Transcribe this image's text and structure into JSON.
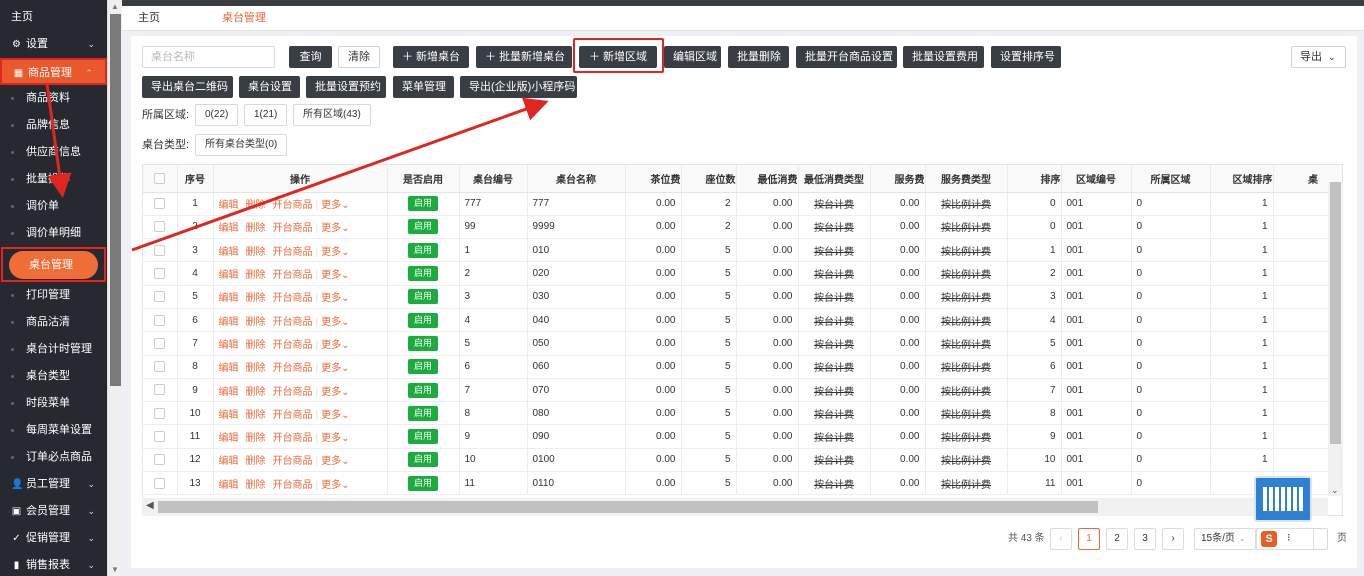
{
  "sidebar": {
    "items": [
      {
        "label": "主页"
      },
      {
        "label": "设置",
        "icon": "gear-icon"
      },
      {
        "label": "商品管理",
        "icon": "grid-icon"
      },
      {
        "label": "商品资料"
      },
      {
        "label": "品牌信息"
      },
      {
        "label": "供应商信息"
      },
      {
        "label": "批量操作"
      },
      {
        "label": "调价单"
      },
      {
        "label": "调价单明细"
      },
      {
        "label": "桌台管理"
      },
      {
        "label": "打印管理"
      },
      {
        "label": "商品沽清"
      },
      {
        "label": "桌台计时管理"
      },
      {
        "label": "桌台类型"
      },
      {
        "label": "时段菜单"
      },
      {
        "label": "每周菜单设置"
      },
      {
        "label": "订单必点商品"
      },
      {
        "label": "员工管理",
        "icon": "user-icon"
      },
      {
        "label": "会员管理",
        "icon": "member-icon"
      },
      {
        "label": "促销管理",
        "icon": "check-circle-icon"
      },
      {
        "label": "销售报表",
        "icon": "bar-chart-icon"
      }
    ]
  },
  "tabs": [
    {
      "label": "主页"
    },
    {
      "label": "桌台管理"
    }
  ],
  "toolbar": {
    "search_placeholder": "桌台名称",
    "query": "查询",
    "clear": "清除",
    "add_table": "＋ 新增桌台",
    "batch_add_table": "＋ 批量新增桌台",
    "add_area": "＋ 新增区域",
    "edit_area": "编辑区域",
    "batch_delete": "批量删除",
    "batch_open_goods": "批量开台商品设置",
    "batch_fee": "批量设置费用",
    "set_sort": "设置排序号",
    "export": "导出",
    "export_qr": "导出桌台二维码",
    "table_settings": "桌台设置",
    "batch_booking": "批量设置预约",
    "menu_mgmt": "菜单管理",
    "export_miniprogram": "导出(企业版)小程序码"
  },
  "filters": {
    "area_label": "所属区域:",
    "area_chips": [
      "0(22)",
      "1(21)",
      "所有区域(43)"
    ],
    "type_label": "桌台类型:",
    "type_chips": [
      "所有桌台类型(0)"
    ]
  },
  "table": {
    "headers": [
      "序号",
      "操作",
      "是否启用",
      "桌台编号",
      "桌台名称",
      "茶位费",
      "座位数",
      "最低消费",
      "最低消费类型",
      "服务费",
      "服务费类型",
      "排序",
      "区域编号",
      "所属区域",
      "区域排序",
      "桌"
    ],
    "ops": [
      "编辑",
      "删除",
      "开台商品",
      "更多"
    ],
    "enabled_label": "启用",
    "rows": [
      {
        "idx": "1",
        "code": "777",
        "name": "777",
        "tea": "0.00",
        "seats": "2",
        "min": "0.00",
        "min_type": "按台计费",
        "svc": "0.00",
        "svc_type": "按比例计费",
        "sort": "0",
        "area_code": "001",
        "area": "0",
        "area_sort": "1"
      },
      {
        "idx": "2",
        "code": "99",
        "name": "9999",
        "tea": "0.00",
        "seats": "2",
        "min": "0.00",
        "min_type": "按台计费",
        "svc": "0.00",
        "svc_type": "按比例计费",
        "sort": "0",
        "area_code": "001",
        "area": "0",
        "area_sort": "1"
      },
      {
        "idx": "3",
        "code": "1",
        "name": "010",
        "tea": "0.00",
        "seats": "5",
        "min": "0.00",
        "min_type": "按台计费",
        "svc": "0.00",
        "svc_type": "按比例计费",
        "sort": "1",
        "area_code": "001",
        "area": "0",
        "area_sort": "1"
      },
      {
        "idx": "4",
        "code": "2",
        "name": "020",
        "tea": "0.00",
        "seats": "5",
        "min": "0.00",
        "min_type": "按台计费",
        "svc": "0.00",
        "svc_type": "按比例计费",
        "sort": "2",
        "area_code": "001",
        "area": "0",
        "area_sort": "1"
      },
      {
        "idx": "5",
        "code": "3",
        "name": "030",
        "tea": "0.00",
        "seats": "5",
        "min": "0.00",
        "min_type": "按台计费",
        "svc": "0.00",
        "svc_type": "按比例计费",
        "sort": "3",
        "area_code": "001",
        "area": "0",
        "area_sort": "1"
      },
      {
        "idx": "6",
        "code": "4",
        "name": "040",
        "tea": "0.00",
        "seats": "5",
        "min": "0.00",
        "min_type": "按台计费",
        "svc": "0.00",
        "svc_type": "按比例计费",
        "sort": "4",
        "area_code": "001",
        "area": "0",
        "area_sort": "1"
      },
      {
        "idx": "7",
        "code": "5",
        "name": "050",
        "tea": "0.00",
        "seats": "5",
        "min": "0.00",
        "min_type": "按台计费",
        "svc": "0.00",
        "svc_type": "按比例计费",
        "sort": "5",
        "area_code": "001",
        "area": "0",
        "area_sort": "1"
      },
      {
        "idx": "8",
        "code": "6",
        "name": "060",
        "tea": "0.00",
        "seats": "5",
        "min": "0.00",
        "min_type": "按台计费",
        "svc": "0.00",
        "svc_type": "按比例计费",
        "sort": "6",
        "area_code": "001",
        "area": "0",
        "area_sort": "1"
      },
      {
        "idx": "9",
        "code": "7",
        "name": "070",
        "tea": "0.00",
        "seats": "5",
        "min": "0.00",
        "min_type": "按台计费",
        "svc": "0.00",
        "svc_type": "按比例计费",
        "sort": "7",
        "area_code": "001",
        "area": "0",
        "area_sort": "1"
      },
      {
        "idx": "10",
        "code": "8",
        "name": "080",
        "tea": "0.00",
        "seats": "5",
        "min": "0.00",
        "min_type": "按台计费",
        "svc": "0.00",
        "svc_type": "按比例计费",
        "sort": "8",
        "area_code": "001",
        "area": "0",
        "area_sort": "1"
      },
      {
        "idx": "11",
        "code": "9",
        "name": "090",
        "tea": "0.00",
        "seats": "5",
        "min": "0.00",
        "min_type": "按台计费",
        "svc": "0.00",
        "svc_type": "按比例计费",
        "sort": "9",
        "area_code": "001",
        "area": "0",
        "area_sort": "1"
      },
      {
        "idx": "12",
        "code": "10",
        "name": "0100",
        "tea": "0.00",
        "seats": "5",
        "min": "0.00",
        "min_type": "按台计费",
        "svc": "0.00",
        "svc_type": "按比例计费",
        "sort": "10",
        "area_code": "001",
        "area": "0",
        "area_sort": "1"
      },
      {
        "idx": "13",
        "code": "11",
        "name": "0110",
        "tea": "0.00",
        "seats": "5",
        "min": "0.00",
        "min_type": "按台计费",
        "svc": "0.00",
        "svc_type": "按比例计费",
        "sort": "11",
        "area_code": "001",
        "area": "0",
        "area_sort": "1"
      }
    ]
  },
  "pagination": {
    "total": "共 43 条",
    "pages": [
      "1",
      "2",
      "3"
    ],
    "current": "1",
    "page_size": "15条/页",
    "page_suffix": "页"
  },
  "colors": {
    "accent": "#e86a3a",
    "sidebar_bg": "#262a30",
    "highlight": "#e0261e",
    "enabled_green": "#1aac3c"
  }
}
